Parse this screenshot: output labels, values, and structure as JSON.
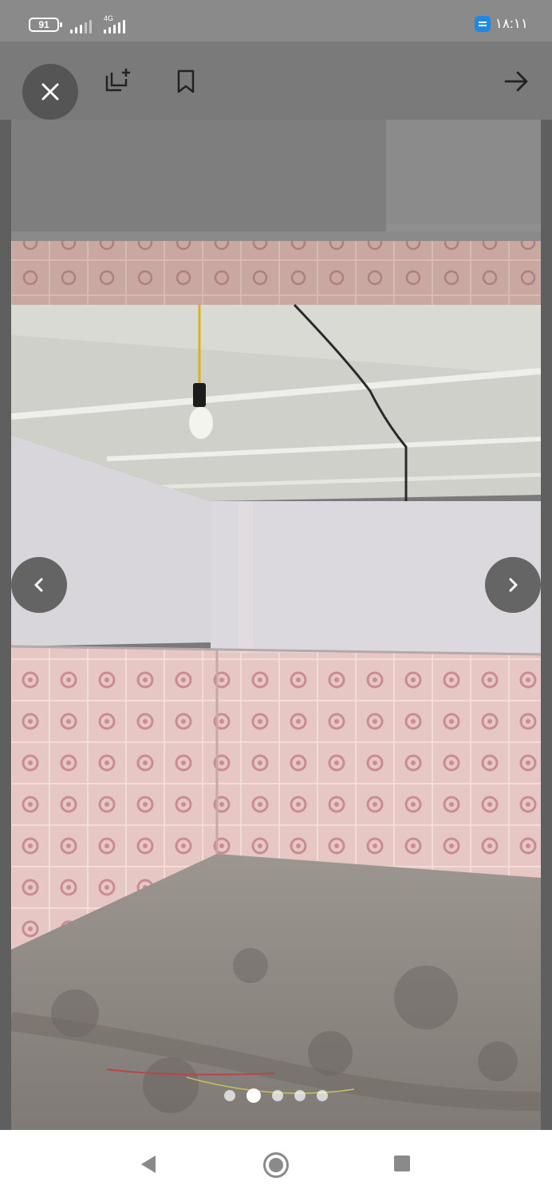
{
  "status_bar": {
    "battery_level": "91",
    "network_label": "4G",
    "time": "۱۸:۱۱"
  },
  "toolbar": {
    "close_icon": "close-icon",
    "icons": [
      "add-to-list-icon",
      "bookmark-icon",
      "arrow-right-icon"
    ]
  },
  "gallery": {
    "total_images": 5,
    "current_index": 2,
    "prev_icon": "chevron-left-icon",
    "next_icon": "chevron-right-icon"
  },
  "system_nav": {
    "icons": [
      "back-triangle-icon",
      "home-circle-icon",
      "recents-square-icon"
    ]
  }
}
